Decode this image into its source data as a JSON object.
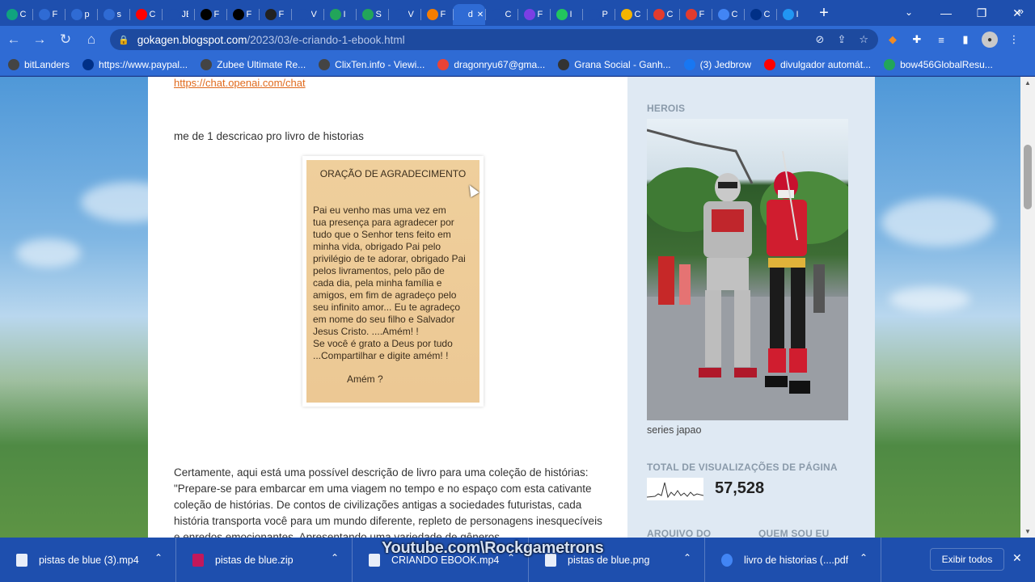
{
  "tabs": [
    {
      "icon": "chatgpt-icon",
      "label": "C",
      "color": "#10a37f"
    },
    {
      "icon": "c-logo-icon",
      "label": "F",
      "color": "#2f6bd4"
    },
    {
      "icon": "c-logo-icon",
      "label": "p",
      "color": "#2f6bd4"
    },
    {
      "icon": "c-logo-icon",
      "label": "s",
      "color": "#2f6bd4"
    },
    {
      "icon": "youtube-icon",
      "label": "C",
      "color": "#ff0000"
    },
    {
      "icon": "je-icon",
      "label": "JE",
      "color": "#1e4fae"
    },
    {
      "icon": "wix-icon",
      "label": "F",
      "color": "#000000"
    },
    {
      "icon": "wix-icon",
      "label": "F",
      "color": "#000000"
    },
    {
      "icon": "r-icon",
      "label": "F",
      "color": "#222222"
    },
    {
      "icon": "v-icon",
      "label": "V",
      "color": "#1e4fae"
    },
    {
      "icon": "puzzle-green-icon",
      "label": "I",
      "color": "#22a55a"
    },
    {
      "icon": "puzzle-green-icon",
      "label": "S",
      "color": "#22a55a"
    },
    {
      "icon": "v-icon",
      "label": "V",
      "color": "#1e4fae"
    },
    {
      "icon": "blogger-icon",
      "label": "F",
      "color": "#f57d00"
    },
    {
      "icon": "d-icon",
      "label": "d",
      "color": "#2f6bd4"
    },
    {
      "icon": "c-icon",
      "label": "C",
      "color": "#1e4fae"
    },
    {
      "icon": "purple-icon",
      "label": "F",
      "color": "#7b3fe4"
    },
    {
      "icon": "play-green-icon",
      "label": "I",
      "color": "#22c55e"
    },
    {
      "icon": "p-icon",
      "label": "P",
      "color": "#1e4fae"
    },
    {
      "icon": "multi-color-icon",
      "label": "C",
      "color": "#f4b400"
    },
    {
      "icon": "flame-icon",
      "label": "C",
      "color": "#e23b2e"
    },
    {
      "icon": "flame-icon",
      "label": "F",
      "color": "#e23b2e"
    },
    {
      "icon": "docs-icon",
      "label": "C",
      "color": "#4285f4"
    },
    {
      "icon": "paypal-icon",
      "label": "C",
      "color": "#003087"
    },
    {
      "icon": "blue-icon",
      "label": "I",
      "color": "#2196f3"
    }
  ],
  "window": {
    "minimize": "—",
    "maximize": "❐",
    "close": "✕",
    "new_tab": "+",
    "tab_search": "⌄"
  },
  "toolbar": {
    "back": "←",
    "forward": "→",
    "reload": "↻",
    "home": "⌂"
  },
  "address": {
    "host": "gokagen.blogspot.com",
    "path": "/2023/03/e-criando-1-ebook.html"
  },
  "bookmarks": [
    {
      "icon": "globe-icon",
      "label": "bitLanders",
      "color": "#444"
    },
    {
      "icon": "paypal-icon",
      "label": "https://www.paypal...",
      "color": "#003087"
    },
    {
      "icon": "globe-icon",
      "label": "Zubee Ultimate Re...",
      "color": "#444"
    },
    {
      "icon": "globe-icon",
      "label": "ClixTen.info - Viewi...",
      "color": "#444"
    },
    {
      "icon": "google-icon",
      "label": "dragonryu67@gma...",
      "color": "#ea4335"
    },
    {
      "icon": "gs-icon",
      "label": "Grana Social - Ganh...",
      "color": "#333"
    },
    {
      "icon": "facebook-icon",
      "label": "(3) Jedbrow",
      "color": "#1877f2"
    },
    {
      "icon": "youtube-icon",
      "label": "divulgador automát...",
      "color": "#ff0000"
    },
    {
      "icon": "puzzle-multi-icon",
      "label": "bow456GlobalResu...",
      "color": "#22a55a"
    }
  ],
  "post": {
    "link_text": "https://chat.openai.com/chat",
    "prompt_text": "me de 1 descricao pro livro de historias",
    "card": {
      "title": "ORAÇÃO DE AGRADECIMENTO",
      "body": "      Pai eu venho mas uma vez em\ntua presença para agradecer por\ntudo que o Senhor tens feito em\nminha vida, obrigado Pai pelo\nprivilégio de te adorar,  obrigado Pai\npelos livramentos,  pelo pão de\ncada dia, pela minha família e\namigos,  em fim de agradeço pelo\nseu infinito amor... Eu te agradeço\nem nome do seu filho e Salvador\nJesus Cristo. ....Amém! !\n  Se você é grato a Deus por tudo\n...Compartilhar e digite amém! !",
      "footer": "Amém ?"
    },
    "description": "Certamente, aqui está uma possível descrição de livro para uma coleção de histórias: \"Prepare-se para embarcar em uma viagem no tempo e no espaço com esta cativante coleção de histórias. De contos de civilizações antigas a sociedades futuristas, cada história transporta você para um mundo diferente, repleto de personagens inesquecíveis e enredos emocionantes. Apresentando uma variedade de gêneros"
  },
  "sidebar": {
    "herois_title": "HEROIS",
    "hero_caption": "series japao",
    "views_title": "TOTAL DE VISUALIZAÇÕES DE PÁGINA",
    "views_count": "57,528",
    "archive_title": "ARQUIVO DO",
    "about_title": "QUEM SOU EU"
  },
  "downloads": [
    {
      "name": "pistas de blue (3).mp4",
      "icon": "video-file-icon",
      "color": "#e8eef9"
    },
    {
      "name": "pistas de blue.zip",
      "icon": "zip-file-icon",
      "color": "#c2185b"
    },
    {
      "name": "CRIANDO EBOOK.mp4",
      "icon": "video-file-icon",
      "color": "#e8eef9"
    },
    {
      "name": "pistas de blue.png",
      "icon": "image-file-icon",
      "color": "#e8eef9"
    },
    {
      "name": "livro de historias (....pdf",
      "icon": "chrome-icon",
      "color": "#4285f4"
    }
  ],
  "show_all": "Exibir todos",
  "watermark": "Youtube.com\\Rockgametrons"
}
